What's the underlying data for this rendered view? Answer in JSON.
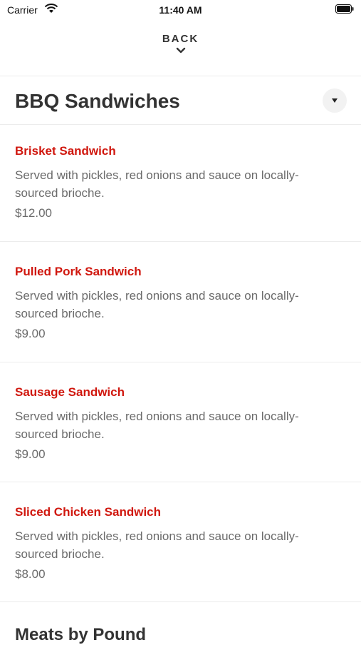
{
  "status_bar": {
    "carrier": "Carrier",
    "time": "11:40 AM"
  },
  "nav": {
    "back_label": "BACK"
  },
  "section": {
    "title": "BBQ Sandwiches",
    "items": [
      {
        "name": "Brisket Sandwich",
        "description": "Served with pickles, red onions and sauce on locally-sourced brioche.",
        "price": "$12.00"
      },
      {
        "name": "Pulled Pork Sandwich",
        "description": "Served with pickles, red onions and sauce on locally-sourced brioche.",
        "price": "$9.00"
      },
      {
        "name": "Sausage Sandwich",
        "description": "Served with pickles, red onions and sauce on locally-sourced brioche.",
        "price": "$9.00"
      },
      {
        "name": "Sliced Chicken Sandwich",
        "description": "Served with pickles, red onions and sauce on locally-sourced brioche.",
        "price": "$8.00"
      }
    ]
  },
  "next_section": {
    "title": "Meats by Pound"
  },
  "colors": {
    "item_name": "#d0170e",
    "text_muted": "#6b6b6b",
    "title": "#333333",
    "divider": "#ececec"
  }
}
